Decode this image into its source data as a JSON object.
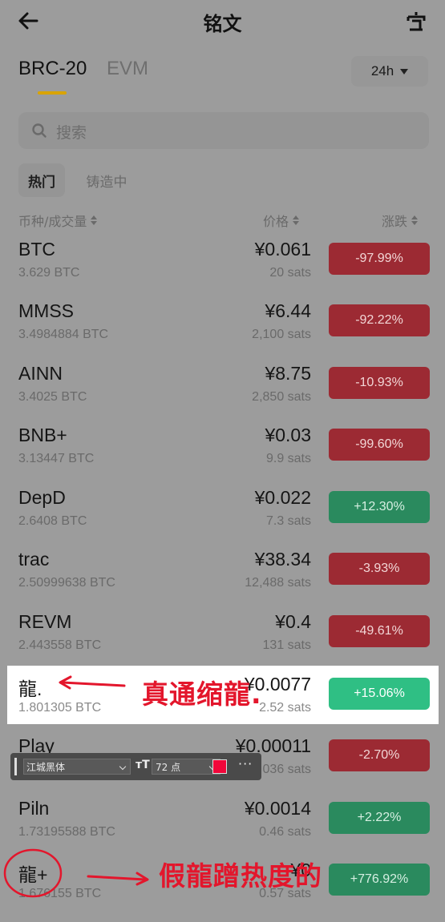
{
  "header": {
    "title": "铭文"
  },
  "tabs": [
    {
      "label": "BRC-20"
    },
    {
      "label": "EVM"
    }
  ],
  "period": {
    "selected": "24h"
  },
  "search": {
    "placeholder": "搜索"
  },
  "filters": [
    {
      "label": "热门"
    },
    {
      "label": "铸造中"
    }
  ],
  "columns": {
    "coin": "币种/成交量",
    "price": "价格",
    "change": "涨跌"
  },
  "rows": [
    {
      "symbol": "BTC",
      "volume": "3.629 BTC",
      "price": "¥0.061",
      "sats": "20 sats",
      "change": "-97.99%",
      "direction": "down"
    },
    {
      "symbol": "MMSS",
      "volume": "3.4984884 BTC",
      "price": "¥6.44",
      "sats": "2,100 sats",
      "change": "-92.22%",
      "direction": "down"
    },
    {
      "symbol": "AINN",
      "volume": "3.4025 BTC",
      "price": "¥8.75",
      "sats": "2,850 sats",
      "change": "-10.93%",
      "direction": "down"
    },
    {
      "symbol": "BNB+",
      "volume": "3.13447 BTC",
      "price": "¥0.03",
      "sats": "9.9 sats",
      "change": "-99.60%",
      "direction": "down"
    },
    {
      "symbol": "DepD",
      "volume": "2.6408 BTC",
      "price": "¥0.022",
      "sats": "7.3 sats",
      "change": "+12.30%",
      "direction": "up"
    },
    {
      "symbol": "trac",
      "volume": "2.50999638 BTC",
      "price": "¥38.34",
      "sats": "12,488 sats",
      "change": "-3.93%",
      "direction": "down"
    },
    {
      "symbol": "REVM",
      "volume": "2.443558 BTC",
      "price": "¥0.4",
      "sats": "131 sats",
      "change": "-49.61%",
      "direction": "down"
    },
    {
      "symbol": "龍.",
      "volume": "1.801305 BTC",
      "price": "¥0.0077",
      "sats": "2.52 sats",
      "change": "+15.06%",
      "direction": "up"
    },
    {
      "symbol": "Play",
      "volume": "",
      "price": "¥0.00011",
      "sats": "036 sats",
      "change": "-2.70%",
      "direction": "down"
    },
    {
      "symbol": "Piln",
      "volume": "1.73195588 BTC",
      "price": "¥0.0014",
      "sats": "0.46 sats",
      "change": "+2.22%",
      "direction": "up"
    },
    {
      "symbol": "龍+",
      "volume": "1.676155 BTC",
      "price": "¥0",
      "sats": "0.57 sats",
      "change": "+776.92%",
      "direction": "up"
    }
  ],
  "annotations": {
    "real": "真通缩龍.",
    "fake": "假龍蹭热度的"
  },
  "editor_toolbar": {
    "font": "江城黑体",
    "size": "72 点",
    "color": "#f2073a",
    "more": "···"
  },
  "colors": {
    "down": "#9c2a33",
    "up": "#2a8a5e",
    "highlight_up": "#2fbf84",
    "accent": "#d9a400",
    "annotation": "#e3162c"
  }
}
